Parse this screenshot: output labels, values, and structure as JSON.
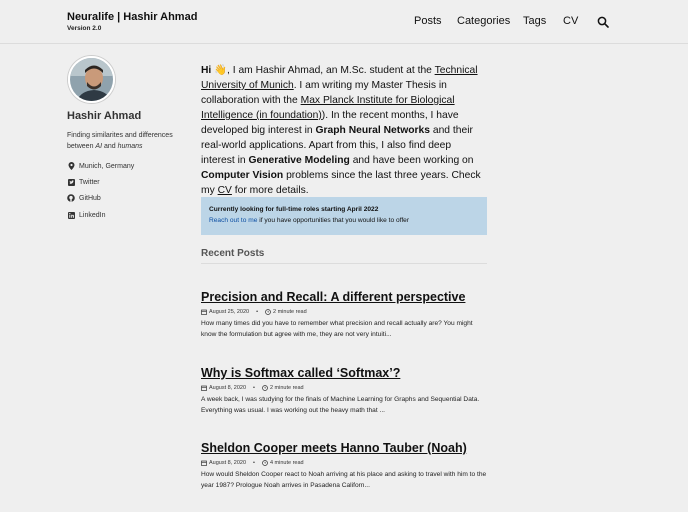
{
  "header": {
    "brand": "Neuralife | Hashir Ahmad",
    "version": "Version 2.0",
    "nav": [
      "Posts",
      "Categories",
      "Tags",
      "CV"
    ]
  },
  "sidebar": {
    "name": "Hashir Ahmad",
    "bio_1": "Finding similarites and differences",
    "bio_2a": "between",
    "bio_ai": "AI",
    "bio_and": "and",
    "bio_humans": "humans",
    "location": "Munich, Germany",
    "links": [
      "Twitter",
      "GitHub",
      "LinkedIn"
    ]
  },
  "intro": {
    "hi": "Hi",
    "wave": "👋",
    "p1": ", I am Hashir Ahmad, an M.Sc. student at the",
    "tum": "Technical University of Munich",
    "p2": ". I am writing my Master Thesis in collaboration with the",
    "mpi": "Max Planck Institute for Biological Intelligence (in foundation)",
    "p3": "). In the recent months, I have developed big interest in",
    "gnn": "Graph Neural Networks",
    "p4": "and their real-world applications. Apart from this, I also find deep interest in",
    "genmod": "Generative Modeling",
    "p5": "and have been working on",
    "cv_topic": "Computer Vision",
    "p6": "problems since the last three years. Check my",
    "cv_link": "CV",
    "p7": "for more details."
  },
  "notice": {
    "bold": "Currently looking for full-time roles starting April 2022",
    "link": "Reach out to me",
    "rest": "if you have opportunities that you would like to offer"
  },
  "recent_posts_label": "Recent Posts",
  "posts": [
    {
      "title": "Precision and Recall: A different perspective",
      "date": "August 25, 2020",
      "read": "2 minute read",
      "excerpt": "How many times did you have to remember what precision and recall actually are? You might know the formulation but agree with me, they are not very intuiti..."
    },
    {
      "title": "Why is Softmax called ‘Softmax’?",
      "date": "August 8, 2020",
      "read": "2 minute read",
      "excerpt": "A week back, I was studying for the finals of Machine Learning for Graphs and Sequential Data. Everything was usual. I was working out the heavy math that ..."
    },
    {
      "title": "Sheldon Cooper meets Hanno Tauber (Noah)",
      "date": "August 8, 2020",
      "read": "4 minute read",
      "excerpt": "How would Sheldon Cooper react to Noah arriving at his place and asking to travel with him to the year 1987? Prologue Noah arrives in Pasadena Californ..."
    }
  ],
  "colors": {
    "background": "#efefef",
    "notice_bg": "#bcd5e7",
    "link": "#0d4fa3"
  },
  "icons": [
    "search-icon",
    "map-pin-icon",
    "twitter-icon",
    "github-icon",
    "linkedin-icon",
    "calendar-icon",
    "clock-icon"
  ]
}
